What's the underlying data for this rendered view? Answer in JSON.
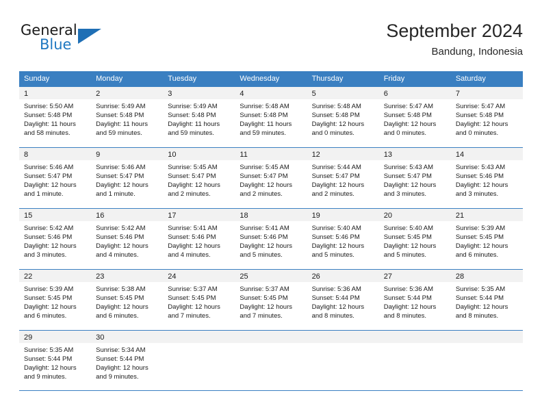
{
  "brand": {
    "name_top": "General",
    "name_bottom": "Blue",
    "triangle_icon": "triangle-logo-icon",
    "color_dark": "#1a1a1a",
    "color_blue": "#1f78c1"
  },
  "header": {
    "title": "September 2024",
    "subtitle": "Bandung, Indonesia"
  },
  "calendar": {
    "accent_color": "#3a7fc1",
    "day_strip_color": "#f2f2f2",
    "weekdays": [
      "Sunday",
      "Monday",
      "Tuesday",
      "Wednesday",
      "Thursday",
      "Friday",
      "Saturday"
    ],
    "weeks": [
      [
        {
          "day": "1",
          "sunrise": "Sunrise: 5:50 AM",
          "sunset": "Sunset: 5:48 PM",
          "daylight": "Daylight: 11 hours and 58 minutes."
        },
        {
          "day": "2",
          "sunrise": "Sunrise: 5:49 AM",
          "sunset": "Sunset: 5:48 PM",
          "daylight": "Daylight: 11 hours and 59 minutes."
        },
        {
          "day": "3",
          "sunrise": "Sunrise: 5:49 AM",
          "sunset": "Sunset: 5:48 PM",
          "daylight": "Daylight: 11 hours and 59 minutes."
        },
        {
          "day": "4",
          "sunrise": "Sunrise: 5:48 AM",
          "sunset": "Sunset: 5:48 PM",
          "daylight": "Daylight: 11 hours and 59 minutes."
        },
        {
          "day": "5",
          "sunrise": "Sunrise: 5:48 AM",
          "sunset": "Sunset: 5:48 PM",
          "daylight": "Daylight: 12 hours and 0 minutes."
        },
        {
          "day": "6",
          "sunrise": "Sunrise: 5:47 AM",
          "sunset": "Sunset: 5:48 PM",
          "daylight": "Daylight: 12 hours and 0 minutes."
        },
        {
          "day": "7",
          "sunrise": "Sunrise: 5:47 AM",
          "sunset": "Sunset: 5:48 PM",
          "daylight": "Daylight: 12 hours and 0 minutes."
        }
      ],
      [
        {
          "day": "8",
          "sunrise": "Sunrise: 5:46 AM",
          "sunset": "Sunset: 5:47 PM",
          "daylight": "Daylight: 12 hours and 1 minute."
        },
        {
          "day": "9",
          "sunrise": "Sunrise: 5:46 AM",
          "sunset": "Sunset: 5:47 PM",
          "daylight": "Daylight: 12 hours and 1 minute."
        },
        {
          "day": "10",
          "sunrise": "Sunrise: 5:45 AM",
          "sunset": "Sunset: 5:47 PM",
          "daylight": "Daylight: 12 hours and 2 minutes."
        },
        {
          "day": "11",
          "sunrise": "Sunrise: 5:45 AM",
          "sunset": "Sunset: 5:47 PM",
          "daylight": "Daylight: 12 hours and 2 minutes."
        },
        {
          "day": "12",
          "sunrise": "Sunrise: 5:44 AM",
          "sunset": "Sunset: 5:47 PM",
          "daylight": "Daylight: 12 hours and 2 minutes."
        },
        {
          "day": "13",
          "sunrise": "Sunrise: 5:43 AM",
          "sunset": "Sunset: 5:47 PM",
          "daylight": "Daylight: 12 hours and 3 minutes."
        },
        {
          "day": "14",
          "sunrise": "Sunrise: 5:43 AM",
          "sunset": "Sunset: 5:46 PM",
          "daylight": "Daylight: 12 hours and 3 minutes."
        }
      ],
      [
        {
          "day": "15",
          "sunrise": "Sunrise: 5:42 AM",
          "sunset": "Sunset: 5:46 PM",
          "daylight": "Daylight: 12 hours and 3 minutes."
        },
        {
          "day": "16",
          "sunrise": "Sunrise: 5:42 AM",
          "sunset": "Sunset: 5:46 PM",
          "daylight": "Daylight: 12 hours and 4 minutes."
        },
        {
          "day": "17",
          "sunrise": "Sunrise: 5:41 AM",
          "sunset": "Sunset: 5:46 PM",
          "daylight": "Daylight: 12 hours and 4 minutes."
        },
        {
          "day": "18",
          "sunrise": "Sunrise: 5:41 AM",
          "sunset": "Sunset: 5:46 PM",
          "daylight": "Daylight: 12 hours and 5 minutes."
        },
        {
          "day": "19",
          "sunrise": "Sunrise: 5:40 AM",
          "sunset": "Sunset: 5:46 PM",
          "daylight": "Daylight: 12 hours and 5 minutes."
        },
        {
          "day": "20",
          "sunrise": "Sunrise: 5:40 AM",
          "sunset": "Sunset: 5:45 PM",
          "daylight": "Daylight: 12 hours and 5 minutes."
        },
        {
          "day": "21",
          "sunrise": "Sunrise: 5:39 AM",
          "sunset": "Sunset: 5:45 PM",
          "daylight": "Daylight: 12 hours and 6 minutes."
        }
      ],
      [
        {
          "day": "22",
          "sunrise": "Sunrise: 5:39 AM",
          "sunset": "Sunset: 5:45 PM",
          "daylight": "Daylight: 12 hours and 6 minutes."
        },
        {
          "day": "23",
          "sunrise": "Sunrise: 5:38 AM",
          "sunset": "Sunset: 5:45 PM",
          "daylight": "Daylight: 12 hours and 6 minutes."
        },
        {
          "day": "24",
          "sunrise": "Sunrise: 5:37 AM",
          "sunset": "Sunset: 5:45 PM",
          "daylight": "Daylight: 12 hours and 7 minutes."
        },
        {
          "day": "25",
          "sunrise": "Sunrise: 5:37 AM",
          "sunset": "Sunset: 5:45 PM",
          "daylight": "Daylight: 12 hours and 7 minutes."
        },
        {
          "day": "26",
          "sunrise": "Sunrise: 5:36 AM",
          "sunset": "Sunset: 5:44 PM",
          "daylight": "Daylight: 12 hours and 8 minutes."
        },
        {
          "day": "27",
          "sunrise": "Sunrise: 5:36 AM",
          "sunset": "Sunset: 5:44 PM",
          "daylight": "Daylight: 12 hours and 8 minutes."
        },
        {
          "day": "28",
          "sunrise": "Sunrise: 5:35 AM",
          "sunset": "Sunset: 5:44 PM",
          "daylight": "Daylight: 12 hours and 8 minutes."
        }
      ],
      [
        {
          "day": "29",
          "sunrise": "Sunrise: 5:35 AM",
          "sunset": "Sunset: 5:44 PM",
          "daylight": "Daylight: 12 hours and 9 minutes."
        },
        {
          "day": "30",
          "sunrise": "Sunrise: 5:34 AM",
          "sunset": "Sunset: 5:44 PM",
          "daylight": "Daylight: 12 hours and 9 minutes."
        },
        {
          "day": "",
          "sunrise": "",
          "sunset": "",
          "daylight": ""
        },
        {
          "day": "",
          "sunrise": "",
          "sunset": "",
          "daylight": ""
        },
        {
          "day": "",
          "sunrise": "",
          "sunset": "",
          "daylight": ""
        },
        {
          "day": "",
          "sunrise": "",
          "sunset": "",
          "daylight": ""
        },
        {
          "day": "",
          "sunrise": "",
          "sunset": "",
          "daylight": ""
        }
      ]
    ]
  }
}
